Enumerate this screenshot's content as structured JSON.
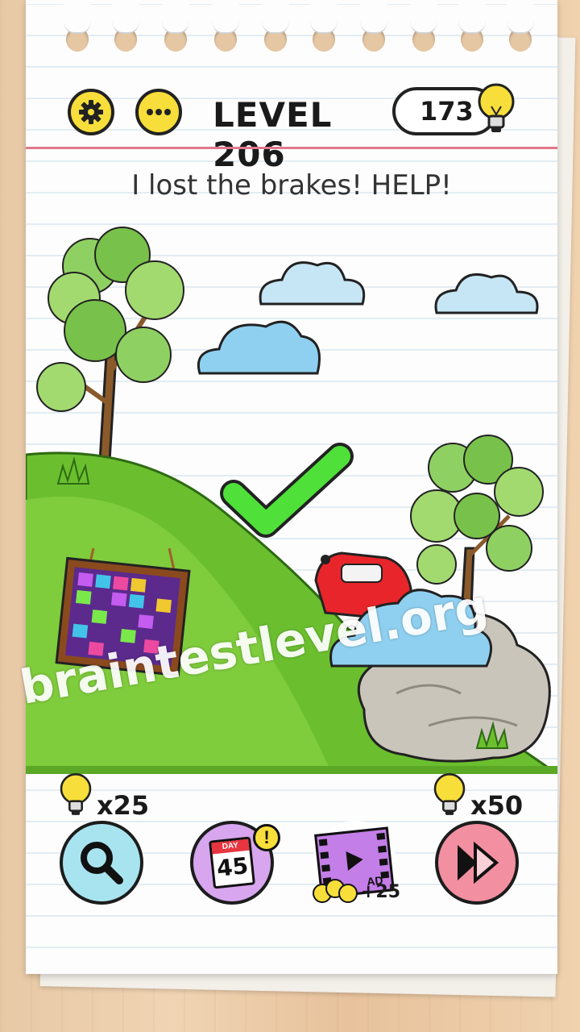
{
  "header": {
    "level_label": "LEVEL 206",
    "hint_count": "173",
    "settings_icon": "gear-icon",
    "menu_icon": "more-dots-icon",
    "bulb_icon": "lightbulb-icon"
  },
  "question": "I lost the brakes! HELP!",
  "watermark": "braintestlevel.org",
  "toolbar": {
    "search_cost": "x25",
    "skip_cost": "x50",
    "calendar_label": "DAY",
    "calendar_day": "45",
    "calendar_alert": "!",
    "ad_label": "AD",
    "ad_reward": "+25"
  },
  "colors": {
    "accent_yellow": "#f7de3a",
    "grass": "#6bbf2f",
    "check": "#4fe03a",
    "skip_pink": "#f28fa0",
    "search_blue": "#a8e4f0",
    "calendar_purple": "#d7a6ee"
  }
}
